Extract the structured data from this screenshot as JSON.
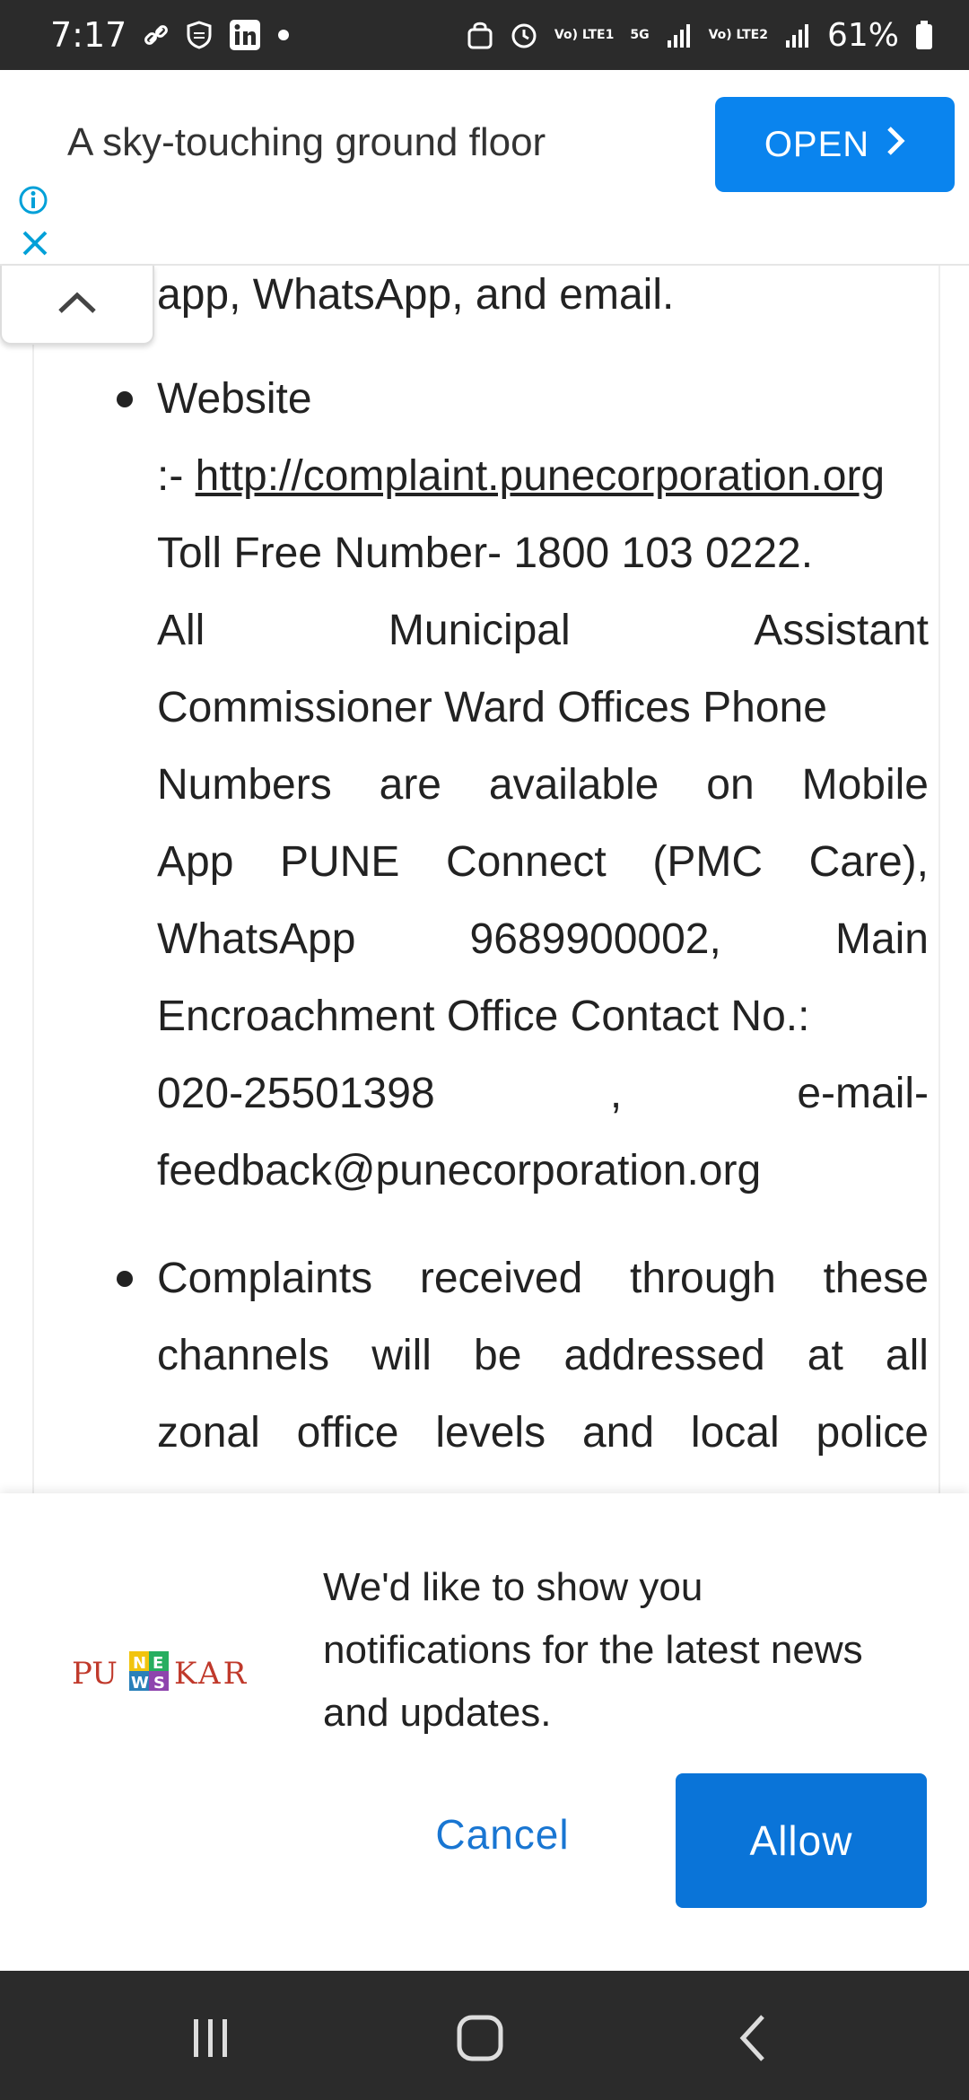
{
  "status_bar": {
    "time": "7:17",
    "battery": "61%",
    "net1": "Vo) LTE1",
    "net2": "Vo) LTE2",
    "five_g": "5G"
  },
  "ad": {
    "text": "A sky-touching ground floor",
    "open_label": "OPEN"
  },
  "article": {
    "line0": "app, WhatsApp, and email.",
    "website_label": "Website",
    "website_prefix": ":- ",
    "website_url": "http://complaint.punecorporation.org",
    "toll_free": "Toll Free Number- 1800 103 0222.",
    "row_all": [
      "All",
      "Municipal",
      "Assistant"
    ],
    "commissioner": "Commissioner Ward Offices Phone",
    "row_numbers": [
      "Numbers",
      "are",
      "available",
      "on",
      "Mobile"
    ],
    "row_app": [
      "App",
      "PUNE",
      "Connect",
      "(PMC",
      "Care),"
    ],
    "row_whatsapp": [
      "WhatsApp",
      "9689900002,",
      "Main"
    ],
    "encroachment": "Encroachment Office Contact No.:",
    "row_phone": [
      "020-25501398",
      ",",
      "e-mail-"
    ],
    "email": "feedback@punecorporation.org",
    "complaints_1": [
      "Complaints",
      "received",
      "through",
      "these"
    ],
    "complaints_2": [
      "channels",
      "will",
      "be",
      "addressed",
      "at",
      "all"
    ],
    "complaints_3": [
      "zonal",
      "office",
      "levels",
      "and",
      "local",
      "police"
    ]
  },
  "notification": {
    "logo_text": "PUNEKAR NEWS",
    "message": "We'd like to show you notifications for the latest news and updates.",
    "cancel_label": "Cancel",
    "allow_label": "Allow"
  },
  "colors": {
    "ad_button": "#0a84ee",
    "allow_button": "#0a74d8",
    "cancel_text": "#1976d2",
    "bars": "#2b2b2b"
  }
}
